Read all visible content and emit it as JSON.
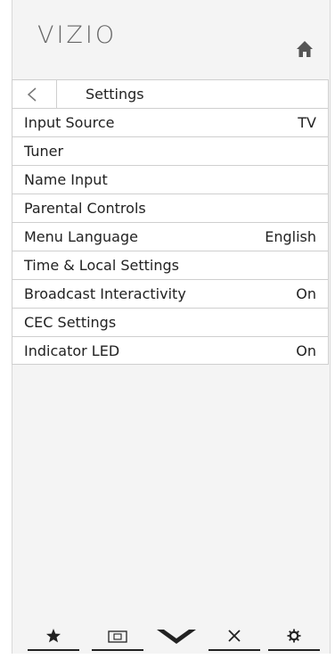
{
  "brand": {
    "logo_text": "VIZIO"
  },
  "header": {
    "title": "Settings",
    "home_icon": "home-icon",
    "back_icon": "back-arrow-icon"
  },
  "menu": {
    "items": [
      {
        "label": "Input Source",
        "value": "TV"
      },
      {
        "label": "Tuner",
        "value": ""
      },
      {
        "label": "Name Input",
        "value": ""
      },
      {
        "label": "Parental Controls",
        "value": ""
      },
      {
        "label": "Menu Language",
        "value": "English"
      },
      {
        "label": "Time & Local Settings",
        "value": ""
      },
      {
        "label": "Broadcast Interactivity",
        "value": "On"
      },
      {
        "label": "CEC Settings",
        "value": ""
      },
      {
        "label": "Indicator LED",
        "value": "On"
      }
    ]
  },
  "bottom_bar": {
    "icons": [
      "star-icon",
      "input-icon",
      "vizio-v-icon",
      "close-icon",
      "gear-icon"
    ]
  },
  "colors": {
    "background": "#f4f4f4",
    "row": "#ffffff",
    "border": "#cfcfcf",
    "text": "#222222",
    "logo": "#666666"
  }
}
